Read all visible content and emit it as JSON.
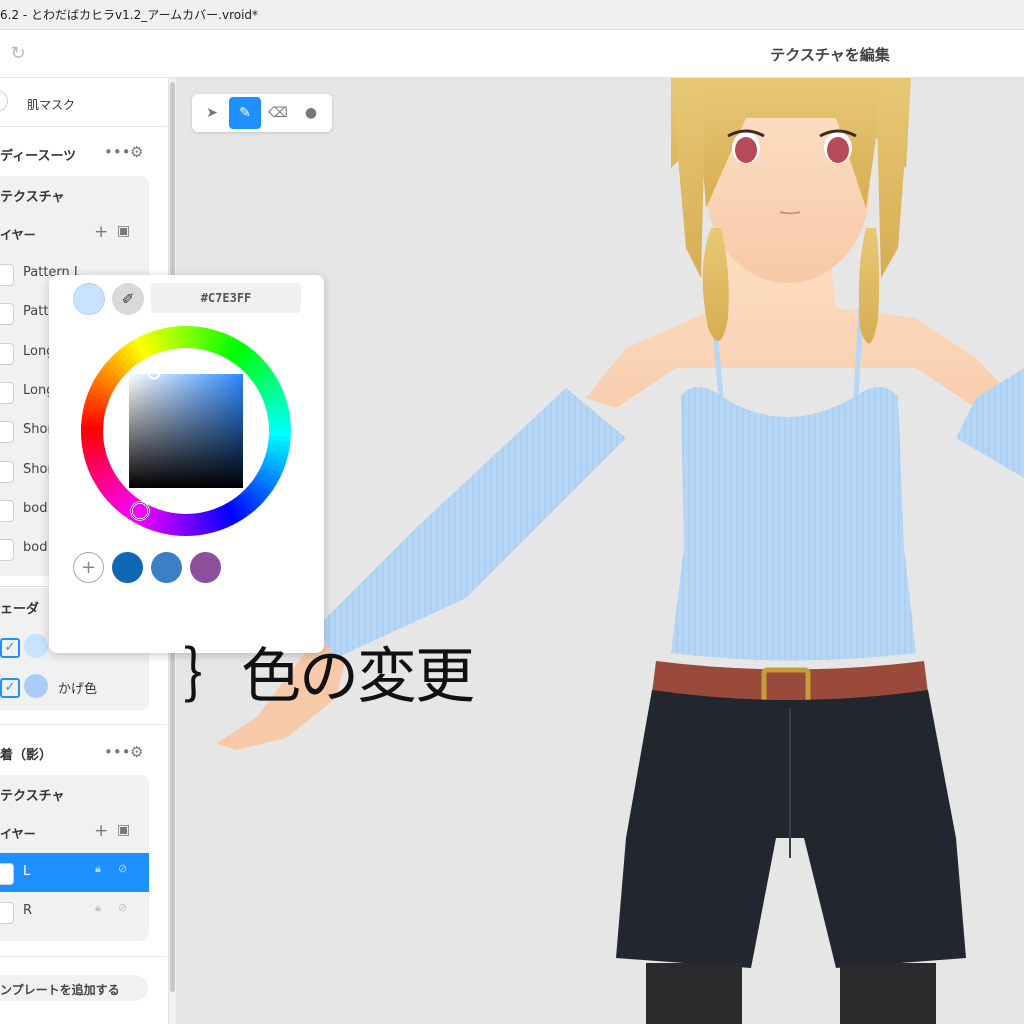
{
  "window": {
    "title": "6.2 - とわだばカヒラv1.2_アームカバー.vroid*"
  },
  "header": {
    "title": "テクスチャを編集"
  },
  "sidebar": {
    "mask_label": "肌マスク",
    "body_suit": {
      "section_title": "ディースーツ",
      "texture_label": "テクスチャ",
      "layer_label": "イヤー",
      "layers": [
        "Pattern L",
        "Patt",
        "Long",
        "Long",
        "Shor",
        "Shor",
        "bod",
        "bod"
      ]
    },
    "shader": {
      "section_title": "ェーダ",
      "shade_label": "かげ色"
    },
    "shadow_section": {
      "section_title": "着（影）",
      "texture_label": "テクスチャ",
      "layer_label": "イヤー",
      "layers": [
        "L",
        "R"
      ]
    },
    "add_template_label": "ンプレートを追加する"
  },
  "toolbar": {
    "tools": [
      "select",
      "pen",
      "eraser",
      "fill"
    ],
    "active": "pen"
  },
  "picker": {
    "hex_value": "#C7E3FF",
    "current_color": "#c7e3ff",
    "presets": [
      "#1067b3",
      "#3b7fc4",
      "#8b4f9c"
    ]
  },
  "annotation": {
    "text": "｝色の変更"
  },
  "colors": {
    "accent": "#1e90ff",
    "garment": "#b6d6f6",
    "shade_swatch": "#a9cdf7"
  }
}
